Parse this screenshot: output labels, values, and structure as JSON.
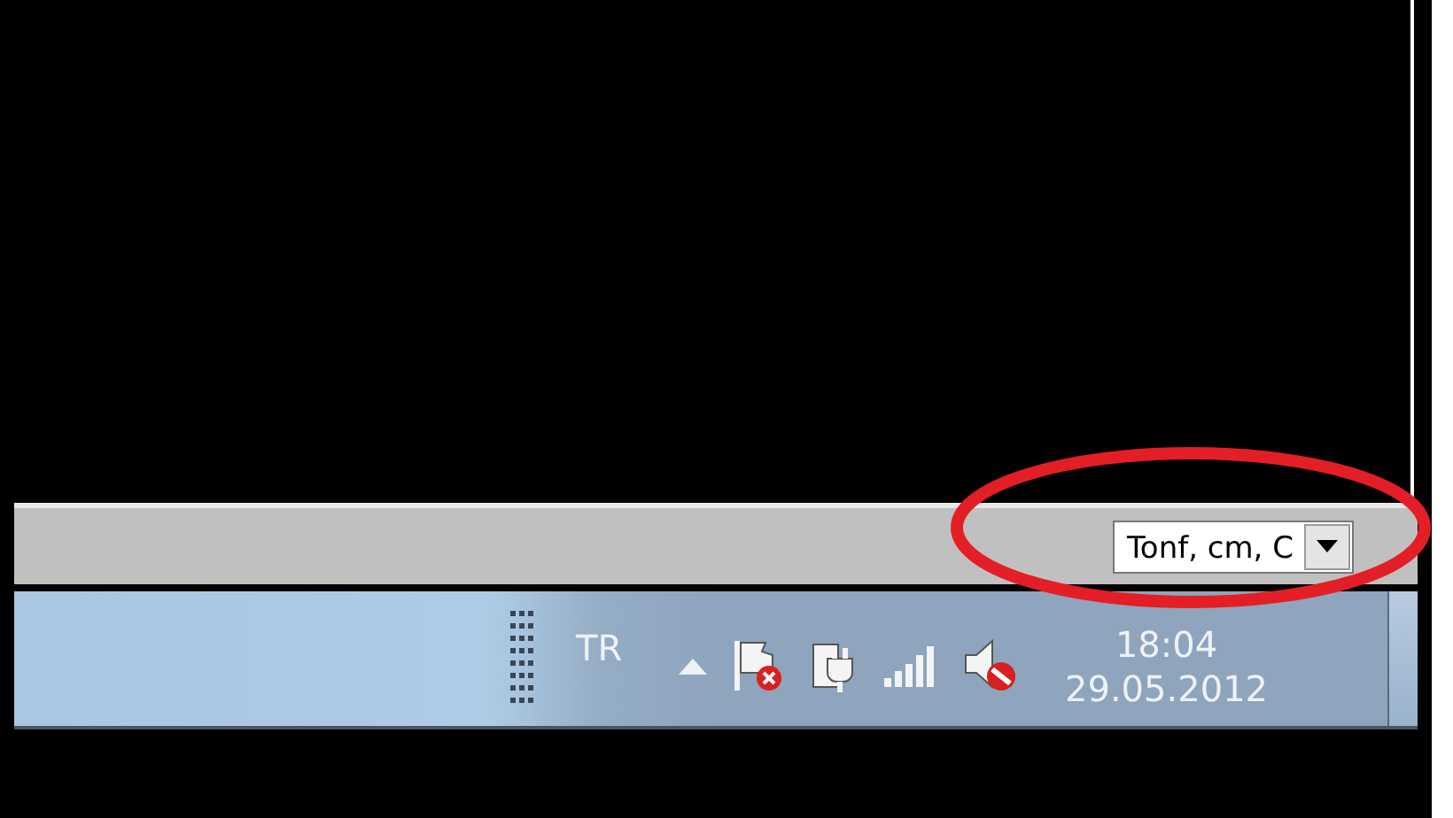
{
  "status_bar": {
    "units_dropdown": {
      "value": "Tonf, cm, C"
    }
  },
  "taskbar": {
    "language": "TR",
    "clock": {
      "time": "18:04",
      "date": "29.05.2012"
    }
  }
}
